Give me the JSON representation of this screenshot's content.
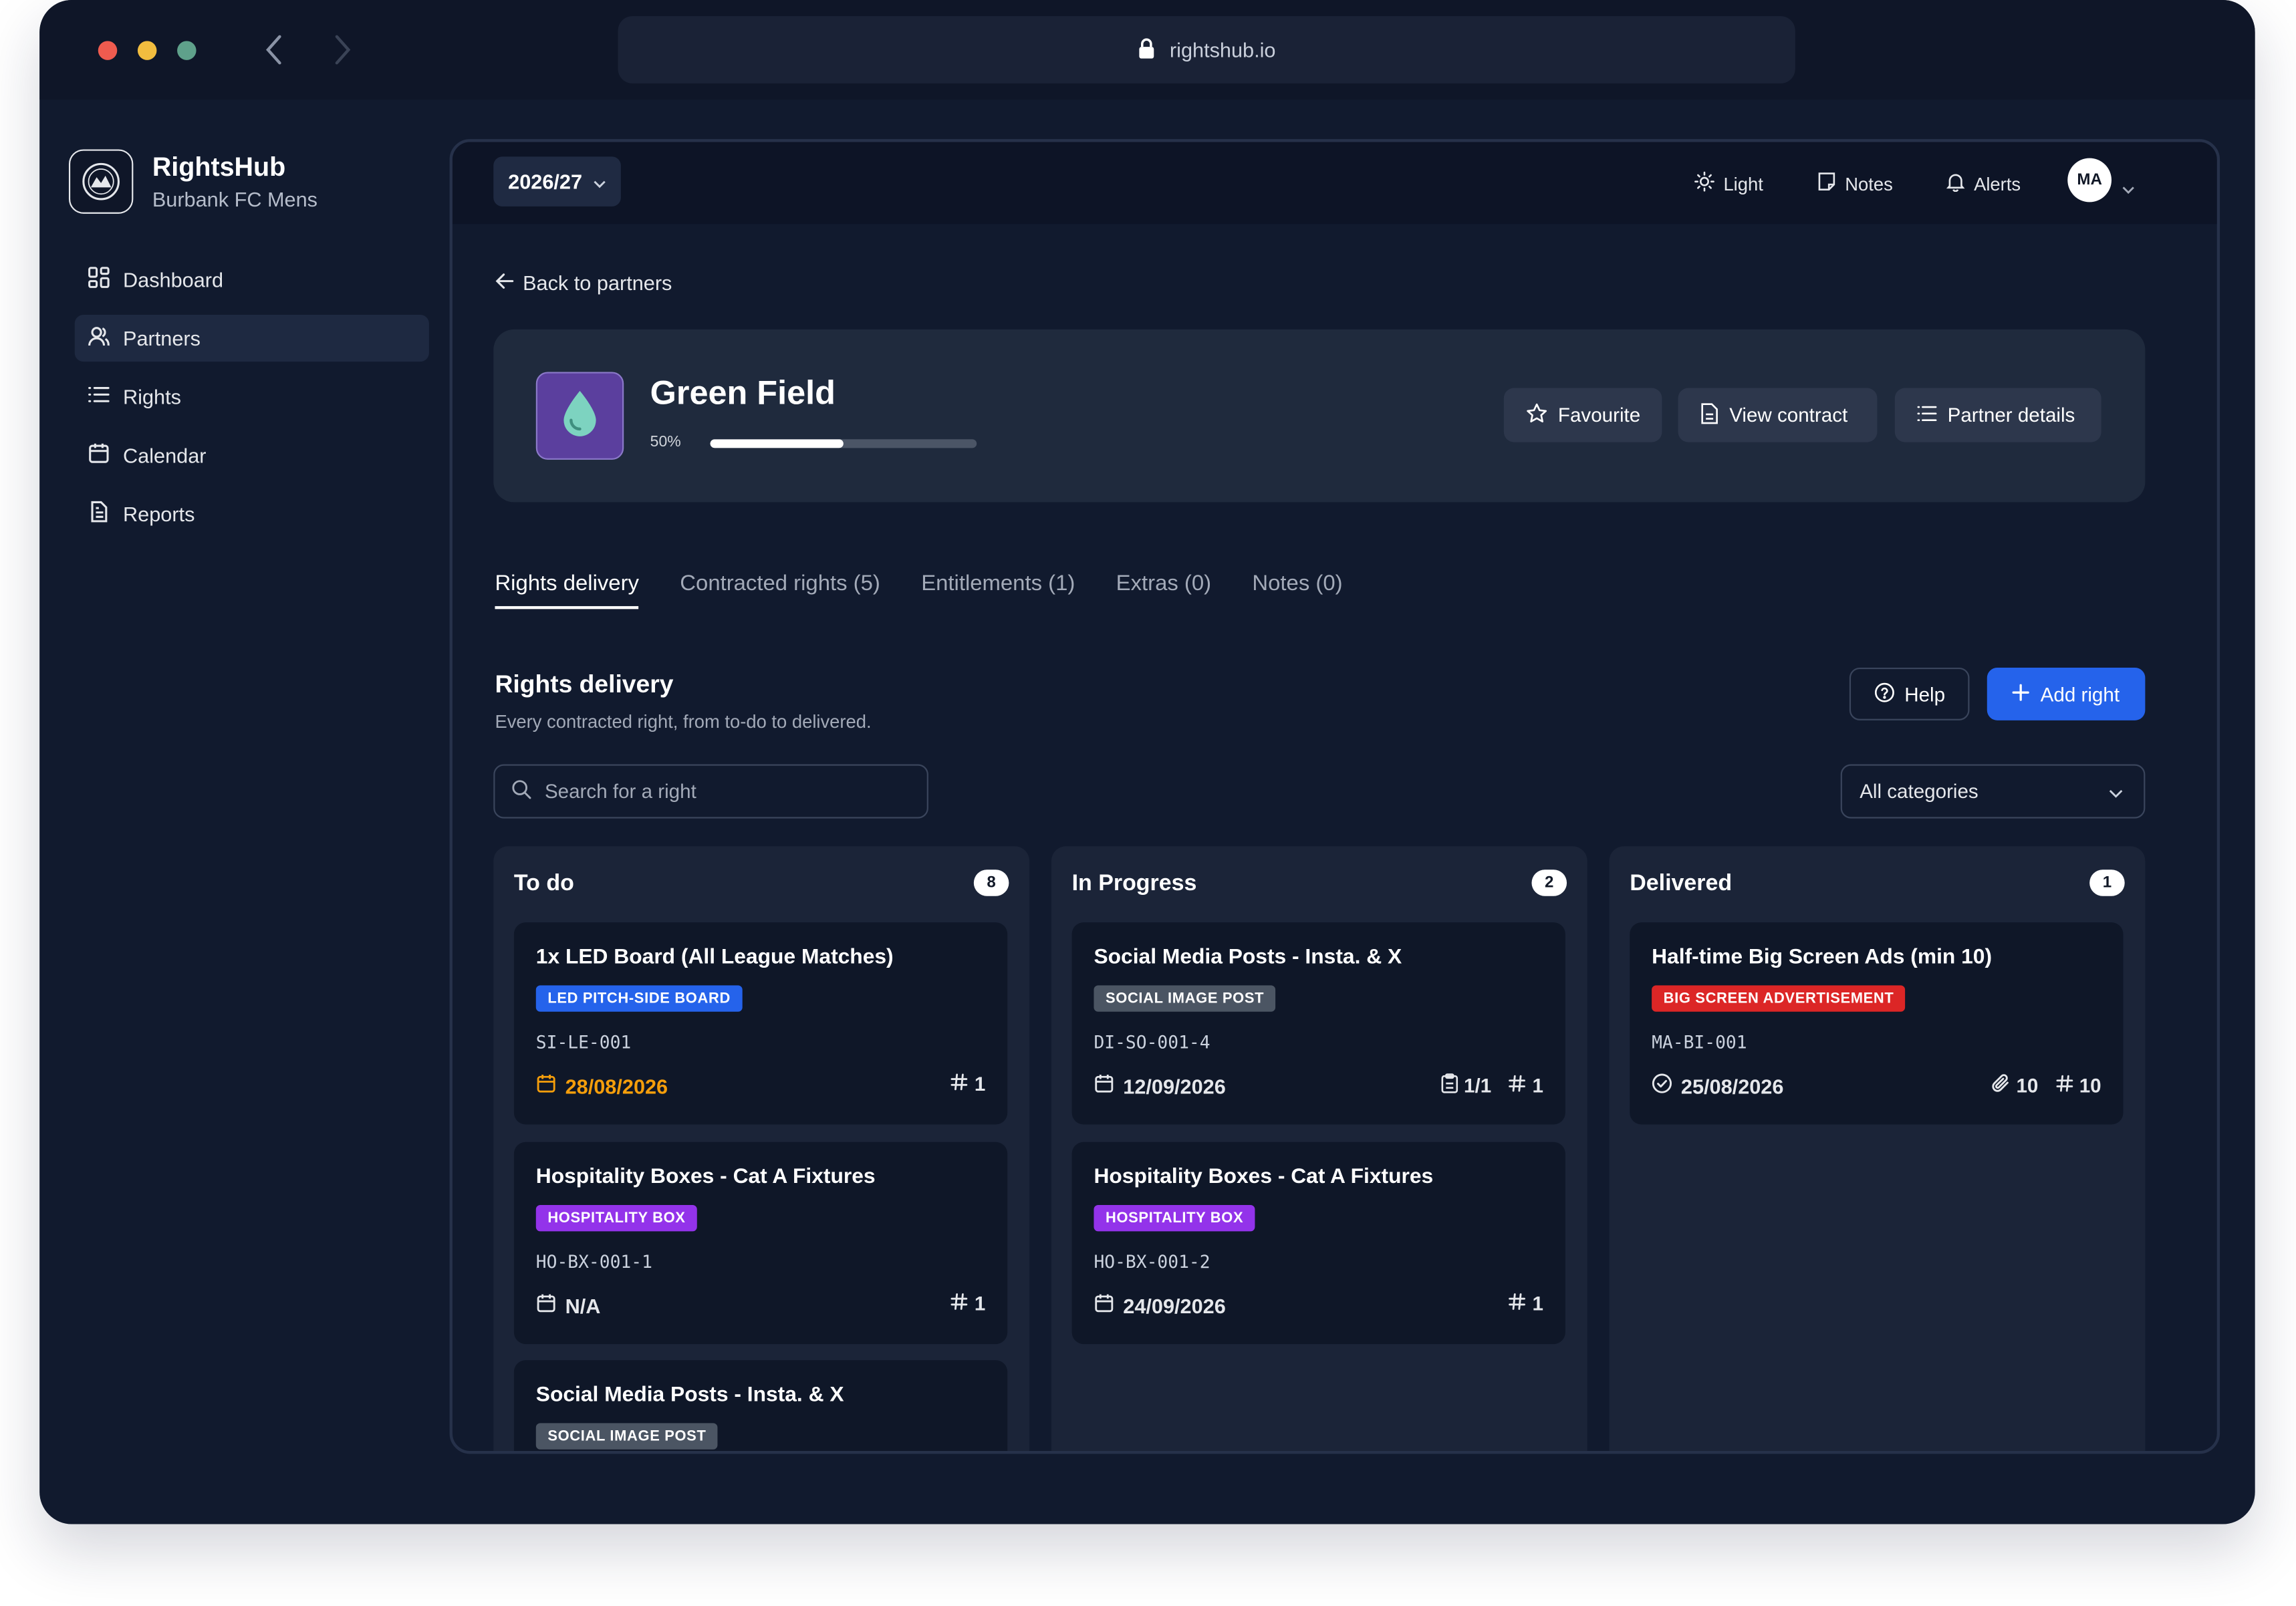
{
  "browser": {
    "url": "rightshub.io"
  },
  "brand": {
    "name": "RightsHub",
    "club": "Burbank FC Mens"
  },
  "sidebar": {
    "items": [
      {
        "label": "Dashboard",
        "icon": "dashboard-icon",
        "active": false
      },
      {
        "label": "Partners",
        "icon": "users-icon",
        "active": true
      },
      {
        "label": "Rights",
        "icon": "list-icon",
        "active": false
      },
      {
        "label": "Calendar",
        "icon": "calendar-icon",
        "active": false
      },
      {
        "label": "Reports",
        "icon": "file-icon",
        "active": false
      }
    ]
  },
  "topbar": {
    "season": "2026/27",
    "theme_label": "Light",
    "notes_label": "Notes",
    "alerts_label": "Alerts",
    "avatar_initials": "MA"
  },
  "page": {
    "back_label": "Back to partners",
    "partner": {
      "name": "Green Field",
      "progress_label": "50%",
      "progress_fraction": 0.5,
      "icon": "water-drop-icon",
      "icon_bg": "#5b3f9e"
    },
    "actions": {
      "favourite": "Favourite",
      "view_contract": "View contract",
      "partner_details": "Partner details"
    },
    "tabs": [
      {
        "label": "Rights delivery",
        "active": true
      },
      {
        "label": "Contracted rights (5)",
        "active": false
      },
      {
        "label": "Entitlements (1)",
        "active": false
      },
      {
        "label": "Extras (0)",
        "active": false
      },
      {
        "label": "Notes (0)",
        "active": false
      }
    ],
    "section": {
      "title": "Rights delivery",
      "subtitle": "Every contracted right, from to-do to delivered.",
      "help_label": "Help",
      "add_label": "Add right",
      "search_placeholder": "Search for a right",
      "category_value": "All categories"
    }
  },
  "board": {
    "todo": {
      "title": "To do",
      "count": "8",
      "cards": [
        {
          "title": "1x LED Board (All League Matches)",
          "tag": "LED PITCH-SIDE BOARD",
          "tag_color": "#2563eb",
          "code": "SI-LE-001",
          "date": "28/08/2026",
          "date_status": "overdue",
          "qty": "1"
        },
        {
          "title": "Hospitality Boxes - Cat A Fixtures",
          "tag": "HOSPITALITY BOX",
          "tag_color": "#9333ea",
          "code": "HO-BX-001-1",
          "date": "N/A",
          "date_status": "normal",
          "qty": "1"
        },
        {
          "title": "Social Media Posts - Insta. & X",
          "tag": "SOCIAL IMAGE POST",
          "tag_color": "#4b5563"
        }
      ]
    },
    "in_progress": {
      "title": "In Progress",
      "count": "2",
      "cards": [
        {
          "title": "Social Media Posts - Insta. & X",
          "tag": "SOCIAL IMAGE POST",
          "tag_color": "#4b5563",
          "code": "DI-SO-001-4",
          "date": "12/09/2026",
          "checklist": "1/1",
          "qty": "1"
        },
        {
          "title": "Hospitality Boxes - Cat A Fixtures",
          "tag": "HOSPITALITY BOX",
          "tag_color": "#9333ea",
          "code": "HO-BX-001-2",
          "date": "24/09/2026",
          "qty": "1"
        }
      ]
    },
    "delivered": {
      "title": "Delivered",
      "count": "1",
      "cards": [
        {
          "title": "Half-time Big Screen Ads (min 10)",
          "tag": "BIG SCREEN ADVERTISEMENT",
          "tag_color": "#dc2626",
          "code": "MA-BI-001",
          "date": "25/08/2026",
          "attachments": "10",
          "qty": "10"
        }
      ]
    }
  }
}
